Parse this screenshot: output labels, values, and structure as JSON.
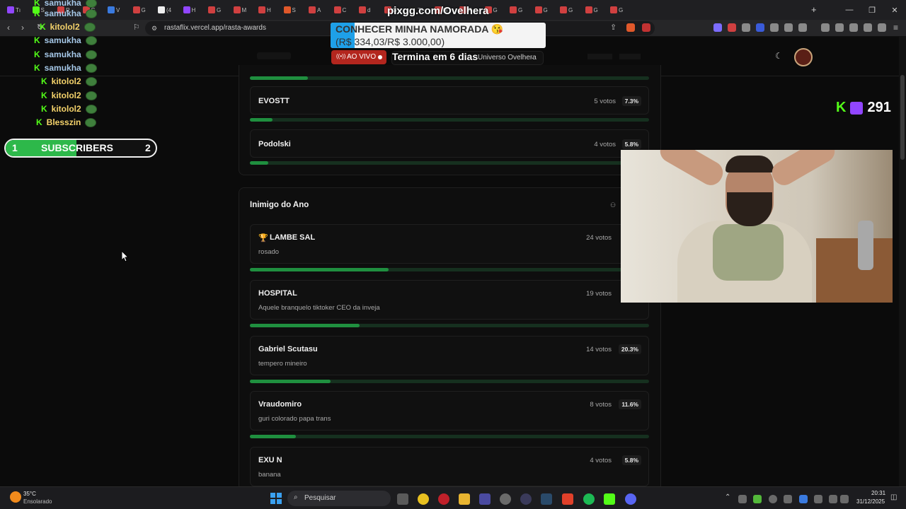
{
  "browser": {
    "url": "rastaflix.vercel.app/rasta-awards",
    "tab_labels": [
      "Tı",
      "S",
      "R",
      "G",
      "V",
      "G",
      "(4",
      "H",
      "G",
      "M",
      "H",
      "S",
      "A",
      "C",
      "d",
      "G",
      "Tí",
      "(4",
      "R",
      "G",
      "G",
      "G",
      "G",
      "G",
      "G"
    ]
  },
  "site": {
    "live_badge": "AO VIVO",
    "countdown": "Termina em 6 dias",
    "nav_item": "Universo Ovelhera"
  },
  "stream_overlay": {
    "donation_url": "pixgg.com/Ovelhera",
    "goal_title": "CONHECER MINHA NAMORADA 😘",
    "goal_amount": "(R$ 334,03/R$ 3.000,00)",
    "goal_progress": 0.111,
    "subs_left": "1",
    "subs_label": "SUBSCRIBERS",
    "subs_right": "2",
    "viewer_count": "291",
    "chat": [
      {
        "user": "samukha",
        "color": "#a6c8e8"
      },
      {
        "user": "samukha",
        "color": "#a6c8e8"
      },
      {
        "user": "kitolol2",
        "color": "#f5d36b"
      },
      {
        "user": "samukha",
        "color": "#a6c8e8"
      },
      {
        "user": "samukha",
        "color": "#a6c8e8"
      },
      {
        "user": "samukha",
        "color": "#a6c8e8"
      },
      {
        "user": "kitolol2",
        "color": "#f5d36b"
      },
      {
        "user": "kitolol2",
        "color": "#f5d36b"
      },
      {
        "user": "kitolol2",
        "color": "#f5d36b"
      },
      {
        "user": "Blesszin",
        "color": "#f5d36b"
      }
    ]
  },
  "awards": {
    "prev_category_rows": [
      {
        "name": "EVOSTT",
        "votes": "5 votos",
        "pct": "7.3%",
        "fill": 0.073
      },
      {
        "name": "Podolski",
        "votes": "4 votos",
        "pct": "5.8%",
        "fill": 0.058
      }
    ],
    "category": {
      "title": "Inimigo do Ano",
      "nominees": [
        {
          "name": "LAMBE SAL",
          "desc": "rosado",
          "votes": "24 votos",
          "pct": "",
          "fill": 0.348,
          "winner": true
        },
        {
          "name": "HOSPITAL",
          "desc": "Aquele branquelo tiktoker CEO da inveja",
          "votes": "19 votos",
          "pct": "",
          "fill": 0.275,
          "winner": false
        },
        {
          "name": "Gabriel Scutasu",
          "desc": "tempero mineiro",
          "votes": "14 votos",
          "pct": "20.3%",
          "fill": 0.203,
          "winner": false
        },
        {
          "name": "Vraudomiro",
          "desc": "guri colorado papa trans",
          "votes": "8 votos",
          "pct": "11.6%",
          "fill": 0.116,
          "winner": false
        },
        {
          "name": "EXU N",
          "desc": "banana",
          "votes": "4 votos",
          "pct": "5.8%",
          "fill": 0.058,
          "winner": false
        }
      ]
    }
  },
  "taskbar": {
    "weather_temp": "35°C",
    "weather_desc": "Ensolarado",
    "search_placeholder": "Pesquisar",
    "time": "20:31",
    "date": "31/12/2025"
  },
  "colors": {
    "accent_green": "#1f8f3f",
    "kick_green": "#53fc18",
    "twitch_purple": "#9146ff",
    "live_red": "#b3261e"
  }
}
